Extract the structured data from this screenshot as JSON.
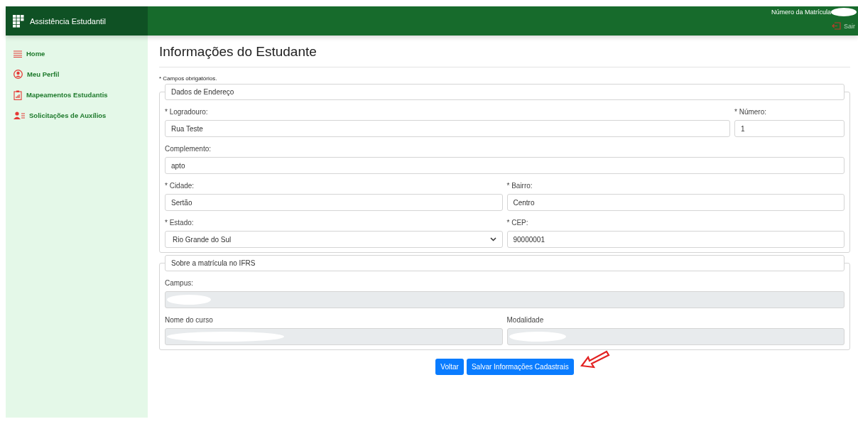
{
  "header": {
    "app_title": "Assistência Estudantil",
    "user_label": "Número da Matrícula",
    "logout": "Sair"
  },
  "sidebar": {
    "items": [
      {
        "label": "Home"
      },
      {
        "label": "Meu Perfil"
      },
      {
        "label": "Mapeamentos Estudantis"
      },
      {
        "label": "Solicitações de Auxílios"
      }
    ]
  },
  "page": {
    "title": "Informações do Estudante",
    "note": "* Campos obrigatórios."
  },
  "sections": [
    {
      "legend": "Dados de Endereço",
      "rows": [
        [
          {
            "label": "* Logradouro:",
            "value": "Rua Teste",
            "kind": "text",
            "disabled": false
          },
          {
            "label": "* Número:",
            "value": "1",
            "kind": "text",
            "disabled": false
          }
        ],
        [
          {
            "label": "Complemento:",
            "value": "apto",
            "kind": "text",
            "disabled": false
          }
        ],
        [
          {
            "label": "* Cidade:",
            "value": "Sertão",
            "kind": "text",
            "disabled": false
          },
          {
            "label": "* Bairro:",
            "value": "Centro",
            "kind": "text",
            "disabled": false
          }
        ],
        [
          {
            "label": "* Estado:",
            "value": "Rio Grande do Sul",
            "kind": "select",
            "disabled": false
          },
          {
            "label": "* CEP:",
            "value": "90000001",
            "kind": "text",
            "disabled": false
          }
        ]
      ]
    },
    {
      "legend": "Sobre a matrícula no IFRS",
      "rows": [
        [
          {
            "label": "Campus:",
            "kind": "text",
            "disabled": true
          }
        ],
        [
          {
            "label": "Nome do curso",
            "kind": "text",
            "disabled": true
          },
          {
            "label": "Modalidade",
            "kind": "text",
            "disabled": true
          }
        ]
      ]
    }
  ],
  "buttons": [
    {
      "label": "Voltar"
    },
    {
      "label": "Salvar Informações Cadastrais",
      "annotated": true
    }
  ]
}
